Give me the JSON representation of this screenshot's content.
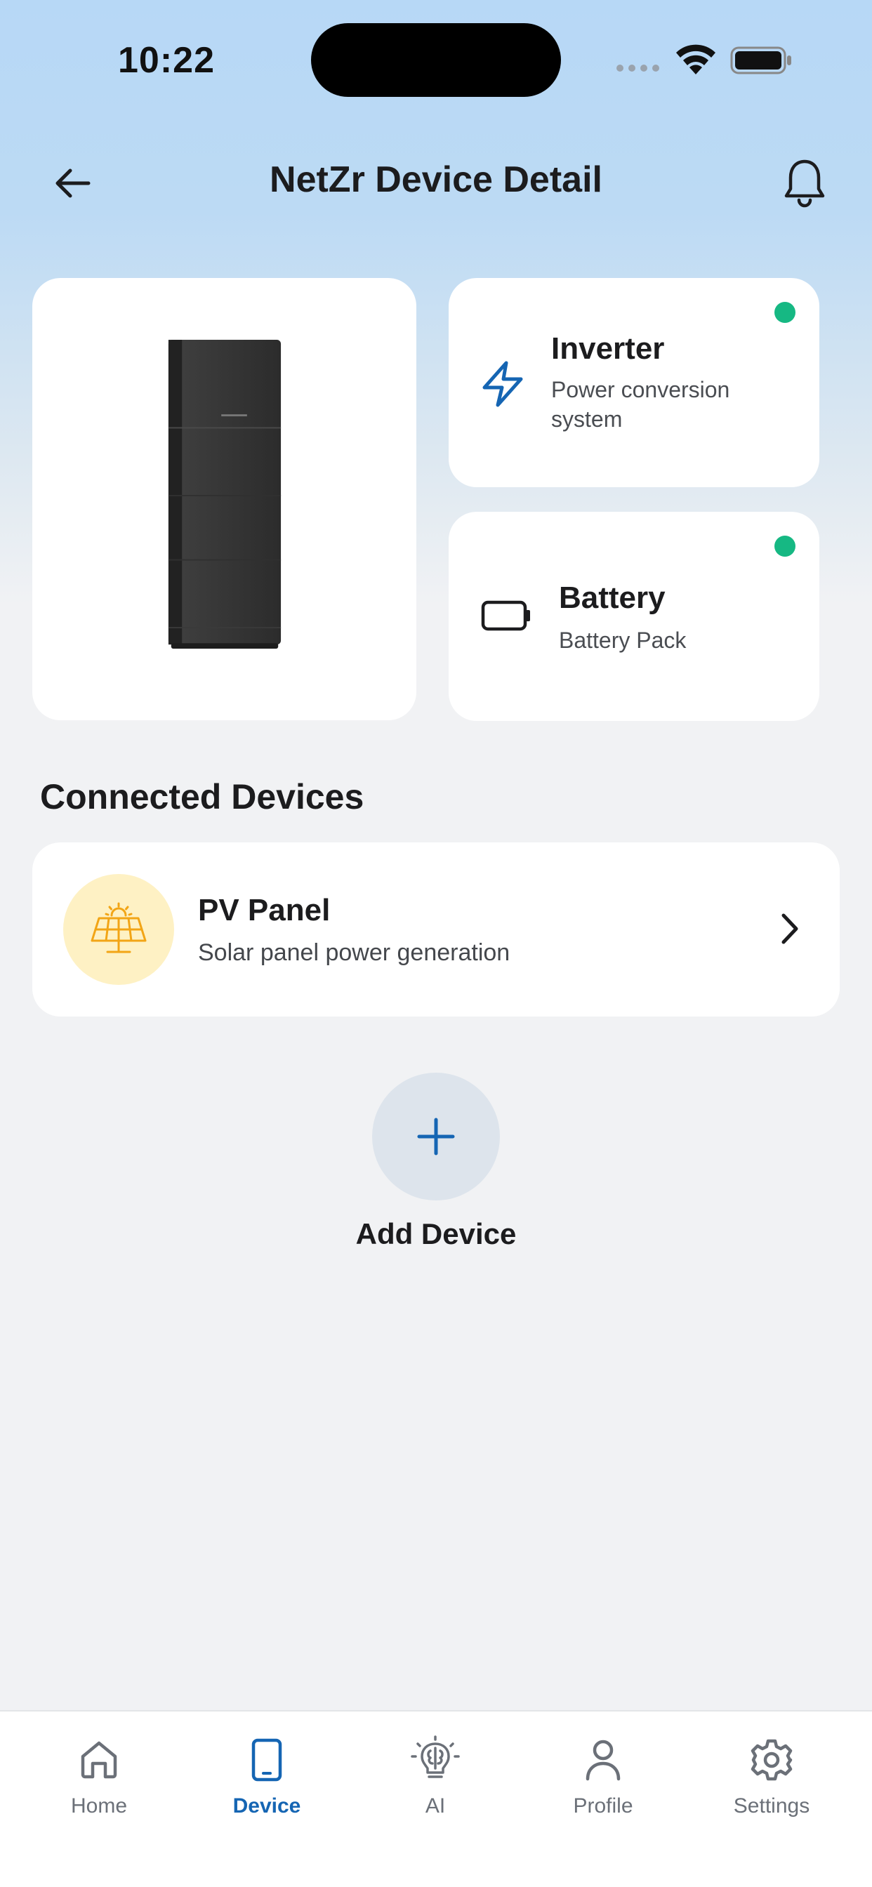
{
  "status_bar": {
    "time": "10:22"
  },
  "header": {
    "title": "NetZr Device Detail"
  },
  "devices": {
    "inverter": {
      "title": "Inverter",
      "subtitle_line1": "Power conversion",
      "subtitle_line2": "system",
      "status_color": "#16b883"
    },
    "battery": {
      "title": "Battery",
      "subtitle": "Battery Pack",
      "status_color": "#16b883"
    }
  },
  "connected": {
    "section_title": "Connected Devices",
    "items": [
      {
        "title": "PV Panel",
        "subtitle": "Solar panel power generation",
        "icon": "solar-panel-icon"
      }
    ]
  },
  "add_device": {
    "label": "Add Device"
  },
  "tabs": [
    {
      "label": "Home",
      "icon": "home-icon",
      "active": false
    },
    {
      "label": "Device",
      "icon": "device-icon",
      "active": true
    },
    {
      "label": "AI",
      "icon": "ai-bulb-icon",
      "active": false
    },
    {
      "label": "Profile",
      "icon": "profile-icon",
      "active": false
    },
    {
      "label": "Settings",
      "icon": "gear-icon",
      "active": false
    }
  ],
  "colors": {
    "accent": "#1565b3",
    "online": "#16b883",
    "solar": "#f2a516"
  }
}
